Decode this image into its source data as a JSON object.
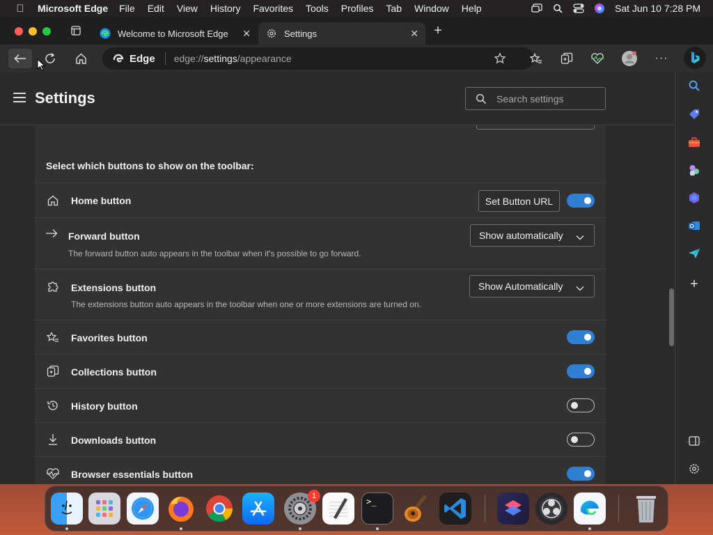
{
  "menubar": {
    "app_name": "Microsoft Edge",
    "items": [
      "File",
      "Edit",
      "View",
      "History",
      "Favorites",
      "Tools",
      "Profiles",
      "Tab",
      "Window",
      "Help"
    ],
    "clock": "Sat Jun 10  7:28 PM"
  },
  "tabs": [
    {
      "title": "Welcome to Microsoft Edge",
      "icon": "edge-logo-icon"
    },
    {
      "title": "Settings",
      "icon": "gear-icon"
    }
  ],
  "address": {
    "badge": "Edge",
    "url_prefix": "edge://",
    "url_bold": "settings",
    "url_suffix": "/appearance"
  },
  "settings": {
    "title": "Settings",
    "search_placeholder": "Search settings",
    "section_heading": "Select which buttons to show on the toolbar:",
    "rows": [
      {
        "label": "Home button",
        "icon": "home-icon",
        "button": "Set Button URL",
        "toggle": true
      },
      {
        "label": "Forward button",
        "icon": "arrow-right-icon",
        "select": "Show automatically",
        "desc": "The forward button auto appears in the toolbar when it's possible to go forward."
      },
      {
        "label": "Extensions button",
        "icon": "puzzle-icon",
        "select": "Show Automatically",
        "desc": "The extensions button auto appears in the toolbar when one or more extensions are turned on."
      },
      {
        "label": "Favorites button",
        "icon": "star-list-icon",
        "toggle": true
      },
      {
        "label": "Collections button",
        "icon": "collections-icon",
        "toggle": true
      },
      {
        "label": "History button",
        "icon": "history-icon",
        "toggle": false
      },
      {
        "label": "Downloads button",
        "icon": "download-icon",
        "toggle": false
      },
      {
        "label": "Browser essentials button",
        "icon": "heartbeat-icon",
        "toggle": true
      }
    ]
  },
  "dock": {
    "apps": [
      "finder",
      "launchpad",
      "safari",
      "firefox",
      "chrome",
      "app-store",
      "system-settings",
      "textedit",
      "terminal",
      "garageband",
      "vscode",
      "shortcuts",
      "obs",
      "edge",
      "trash"
    ],
    "system_settings_badge": "1"
  },
  "colors": {
    "accent": "#2f7fd3",
    "background": "#2b2b2b",
    "panel": "#323232"
  }
}
